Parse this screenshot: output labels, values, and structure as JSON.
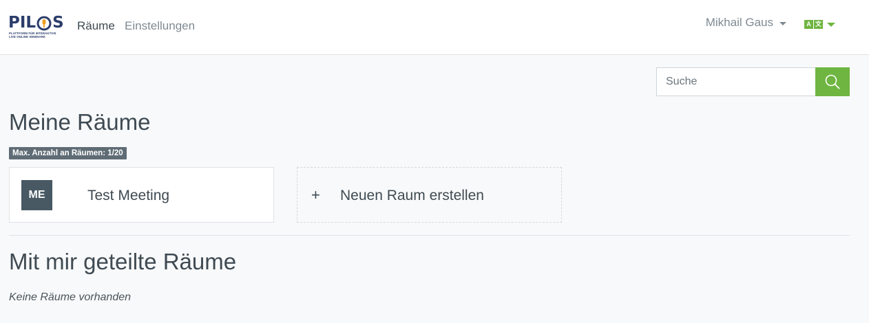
{
  "brand": {
    "logo_text_left": "PIL",
    "logo_text_right": "S",
    "subtitle_line1": "PLATTFORM FÜR INTERAKTIVE",
    "subtitle_line2": "LIVE ONLINE SEMINARE",
    "logo_icon": "microphone-o-icon",
    "colors": {
      "navy": "#2b3d6b",
      "orange": "#f0a020"
    }
  },
  "nav": {
    "items": [
      {
        "label": "Räume",
        "active": true
      },
      {
        "label": "Einstellungen",
        "active": false
      }
    ]
  },
  "user": {
    "name": "Mikhail Gaus"
  },
  "language": {
    "icon": "language-icon",
    "glyph_left": "A",
    "glyph_right": "文"
  },
  "search": {
    "placeholder": "Suche",
    "icon": "search-icon"
  },
  "my_rooms": {
    "title": "Meine Räume",
    "limit_badge": "Max. Anzahl an Räumen: 1/20",
    "rooms": [
      {
        "initials": "ME",
        "name": "Test Meeting"
      }
    ],
    "create_label": "Neuen Raum erstellen",
    "create_icon": "+"
  },
  "shared_rooms": {
    "title": "Mit mir geteilte Räume",
    "empty_text": "Keine Räume vorhanden"
  },
  "colors": {
    "accent": "#6fb541",
    "text": "#3f4a52",
    "muted": "#7f8a92",
    "avatar": "#485963",
    "badge": "#5f6c75",
    "background": "#f8f9fa"
  }
}
